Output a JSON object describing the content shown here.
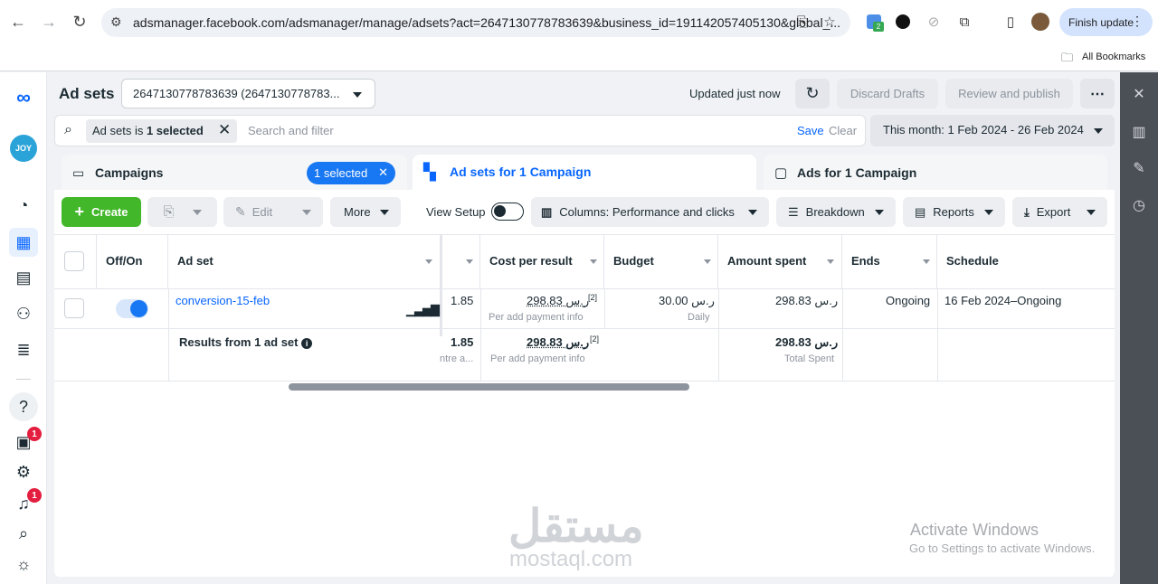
{
  "browser": {
    "url": "adsmanager.facebook.com/adsmanager/manage/adsets?act=2647130778783639&business_id=191142057405130&global_...",
    "finish_update": "Finish update",
    "bookmarks": "All Bookmarks",
    "ext_badge": "2"
  },
  "header": {
    "title": "Ad sets",
    "account": "2647130778783639 (2647130778783...",
    "updated": "Updated just now",
    "discard": "Discard Drafts",
    "review": "Review and publish"
  },
  "search": {
    "filter_prefix": "Ad sets is ",
    "filter_value": "1 selected",
    "placeholder": "Search and filter",
    "save": "Save",
    "clear": "Clear",
    "date_range": "This month: 1 Feb 2024 - 26 Feb 2024"
  },
  "tabs": {
    "campaigns": "Campaigns",
    "selected_pill": "1 selected",
    "adsets": "Ad sets for 1 Campaign",
    "ads": "Ads for 1 Campaign"
  },
  "toolbar": {
    "create": "Create",
    "edit": "Edit",
    "more": "More",
    "view_setup": "View Setup",
    "columns": "Columns: Performance and clicks",
    "breakdown": "Breakdown",
    "reports": "Reports",
    "export": "Export"
  },
  "table": {
    "headers": {
      "offon": "Off/On",
      "adset": "Ad set",
      "cost": "Cost per result",
      "budget": "Budget",
      "spent": "Amount spent",
      "ends": "Ends",
      "schedule": "Schedule"
    },
    "row": {
      "name": "conversion-15-feb",
      "partial_value": "1.85",
      "cost": "298.83 ر.س",
      "cost_note": "[2]",
      "cost_sub": "Per add payment info",
      "budget": "30.00 ر.س",
      "budget_sub": "Daily",
      "spent": "298.83 ر.س",
      "ends": "Ongoing",
      "schedule": "16 Feb 2024–Ongoing"
    },
    "results": {
      "label": "Results from 1 ad set",
      "partial_value": "1.85",
      "partial_sub": "ntre a...",
      "cost": "298.83 ر.س",
      "cost_note": "[2]",
      "cost_sub": "Per add payment info",
      "spent": "298.83 ر.س",
      "spent_sub": "Total Spent"
    }
  },
  "left_rail": {
    "logo_text": "JOY",
    "notif_badge_1": "1",
    "notif_badge_2": "1"
  },
  "watermark": {
    "arabic": "مستقل",
    "latin": "mostaql.com"
  },
  "windows": {
    "title": "Activate Windows",
    "subtitle": "Go to Settings to activate Windows."
  },
  "colors": {
    "accent": "#1877f2",
    "create_green": "#42b72a",
    "toggle_blue": "#1877f2"
  }
}
